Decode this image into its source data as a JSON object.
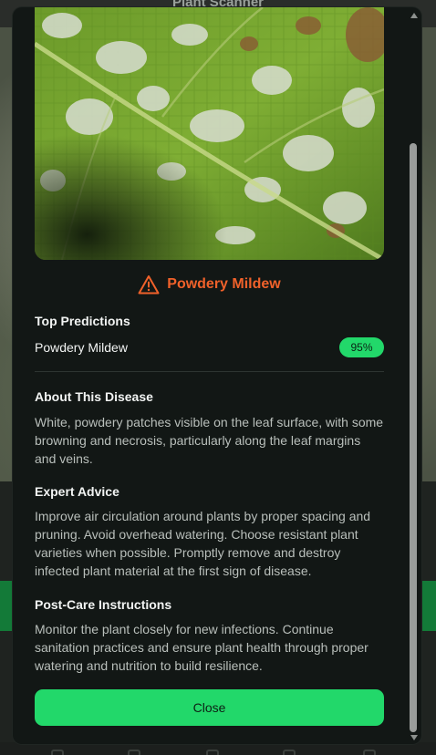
{
  "background_app": {
    "title": "Plant Scanner"
  },
  "modal": {
    "image": {
      "description": "leaf-photo",
      "alt": "Leaf with powdery mildew"
    },
    "disease": {
      "icon": "warning-triangle-icon",
      "name": "Powdery Mildew",
      "color": "#f0612a"
    },
    "top_predictions": {
      "heading": "Top Predictions",
      "items": [
        {
          "name": "Powdery Mildew",
          "confidence": "95%"
        }
      ]
    },
    "about": {
      "heading": "About This Disease",
      "text": "White, powdery patches visible on the leaf surface, with some browning and necrosis, particularly along the leaf margins and veins."
    },
    "expert_advice": {
      "heading": "Expert Advice",
      "text": "Improve air circulation around plants by proper spacing and pruning. Avoid overhead watering. Choose resistant plant varieties when possible. Promptly remove and destroy infected plant material at the first sign of disease."
    },
    "post_care": {
      "heading": "Post-Care Instructions",
      "text": "Monitor the plant closely for new infections. Continue sanitation practices and ensure plant health through proper watering and nutrition to build resilience."
    },
    "close_label": "Close"
  },
  "colors": {
    "accent_green": "#22d86a",
    "modal_bg": "#121715",
    "warning_orange": "#f0612a"
  }
}
